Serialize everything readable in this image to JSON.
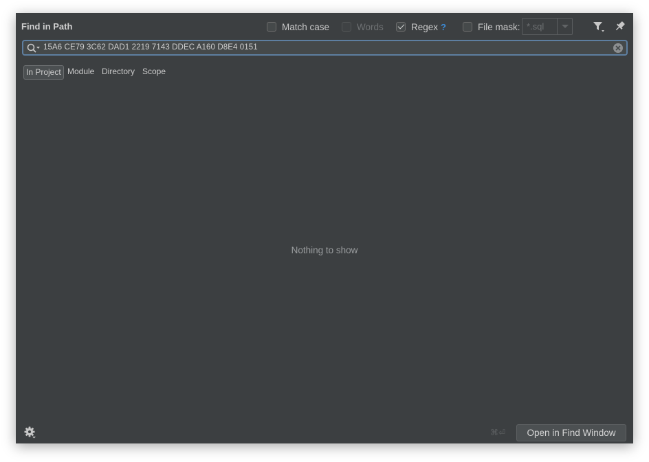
{
  "dialog": {
    "title": "Find in Path"
  },
  "options": {
    "match_case": {
      "label": "Match case",
      "checked": false
    },
    "words": {
      "label": "Words",
      "checked": false,
      "disabled": true
    },
    "regex": {
      "label": "Regex",
      "help": "?",
      "checked": true
    },
    "file_mask": {
      "label": "File mask:",
      "checked": false,
      "value": "*.sql"
    }
  },
  "toolbar": {
    "filter_icon": "filter-icon",
    "pin_icon": "pin-icon"
  },
  "search": {
    "query": "15A6 CE79 3C62 DAD1 2219 7143 DDEC A160 D8E4 0151",
    "icon": "search-icon",
    "clear_icon": "clear-icon"
  },
  "scopes": [
    {
      "label": "In Project",
      "active": true
    },
    {
      "label": "Module",
      "active": false
    },
    {
      "label": "Directory",
      "active": false
    },
    {
      "label": "Scope",
      "active": false
    }
  ],
  "results": {
    "empty_text": "Nothing to show"
  },
  "footer": {
    "settings_icon": "gear-icon",
    "shortcut": "⌘⏎",
    "open_button": "Open in Find Window"
  },
  "colors": {
    "background": "#3c3f41",
    "focus_border": "#5e7fa1",
    "help": "#3d8bd6"
  }
}
